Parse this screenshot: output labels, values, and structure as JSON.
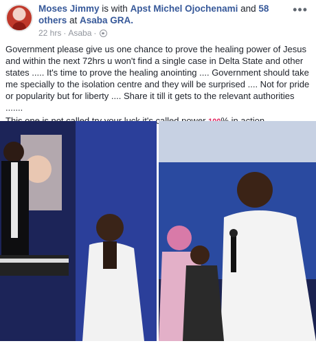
{
  "post": {
    "author": "Moses Jimmy",
    "with_text": " is with ",
    "tagged_person": "Apst Michel Ojochenami",
    "and_text": " and ",
    "others": "58 others",
    "at_text": " at ",
    "location": "Asaba GRA.",
    "time": "22 hrs",
    "place": "Asaba",
    "dot": "·",
    "more_label": "•••",
    "paragraph1": "Government please give us one chance to prove the healing power of Jesus and within the next 72hrs u won't find a single case in Delta State and other states ..... It's time to prove the healing anointing .... Government should take me specially to the isolation centre and they will be surprised .... Not for pride or popularity but for liberty .... Share it till it gets to the relevant authorities .......",
    "paragraph2_start": "This one is not called try your luck it's called power ",
    "hundred_emoji": "100",
    "paragraph2_end": "% in action"
  },
  "icons": {
    "globe": "globe-icon",
    "more": "more-options-icon"
  }
}
